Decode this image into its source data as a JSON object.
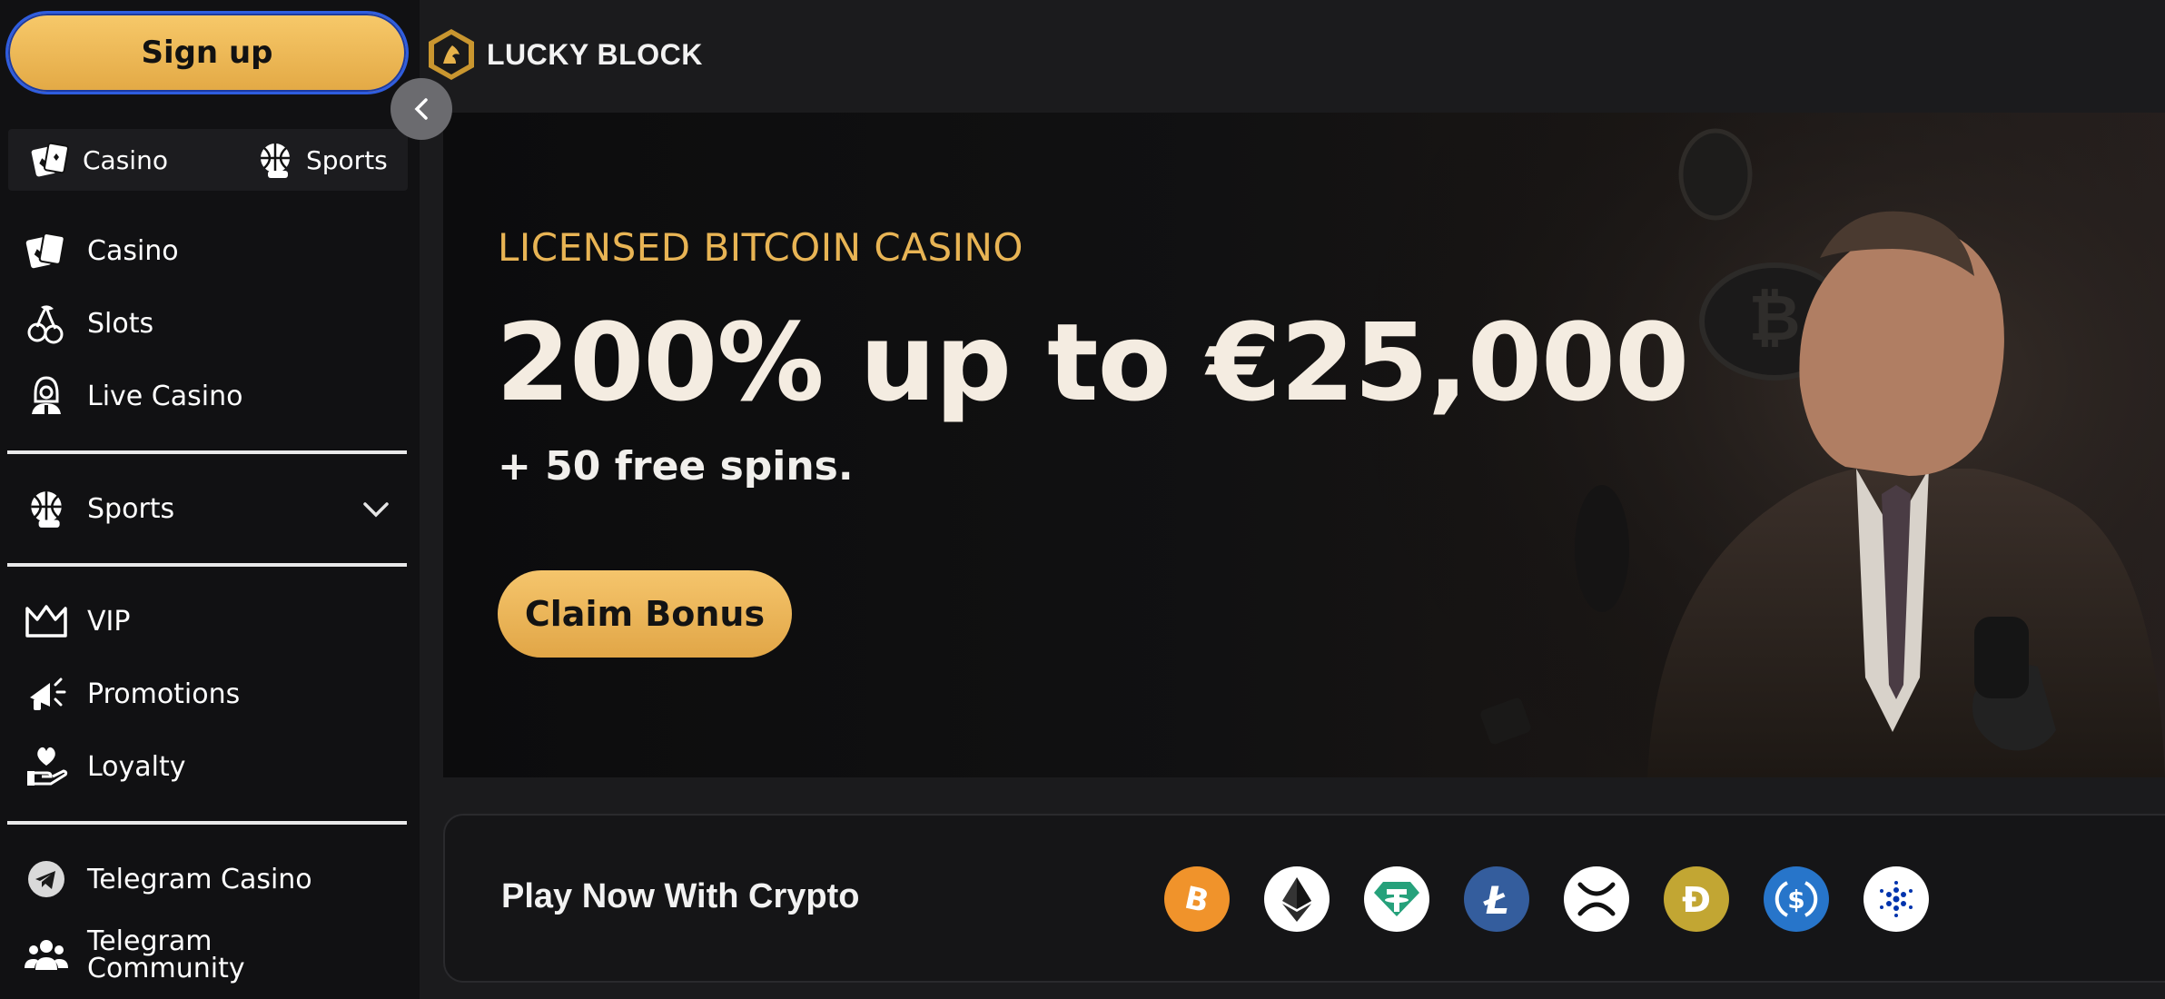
{
  "sidebar": {
    "signup_label": "Sign up",
    "switcher": {
      "casino": "Casino",
      "sports": "Sports"
    },
    "nav": {
      "casino": "Casino",
      "slots": "Slots",
      "live_casino": "Live Casino",
      "sports": "Sports",
      "vip": "VIP",
      "promotions": "Promotions",
      "loyalty": "Loyalty",
      "telegram_casino": "Telegram Casino",
      "telegram_community_1": "Telegram",
      "telegram_community_2": "Community"
    }
  },
  "header": {
    "brand": "LUCKY BLOCK"
  },
  "hero": {
    "eyebrow": "LICENSED BITCOIN CASINO",
    "headline": "200% up to €25,000",
    "sub": "+ 50 free spins.",
    "cta": "Claim Bonus"
  },
  "crypto": {
    "title": "Play Now With Crypto",
    "coins": [
      "bitcoin-icon",
      "ethereum-icon",
      "tether-icon",
      "litecoin-icon",
      "xrp-icon",
      "dogecoin-icon",
      "usdc-icon",
      "cardano-icon"
    ]
  },
  "colors": {
    "accent": "#e8b454",
    "button_gold": "#f0bb5c",
    "bg": "#1b1b1d"
  }
}
